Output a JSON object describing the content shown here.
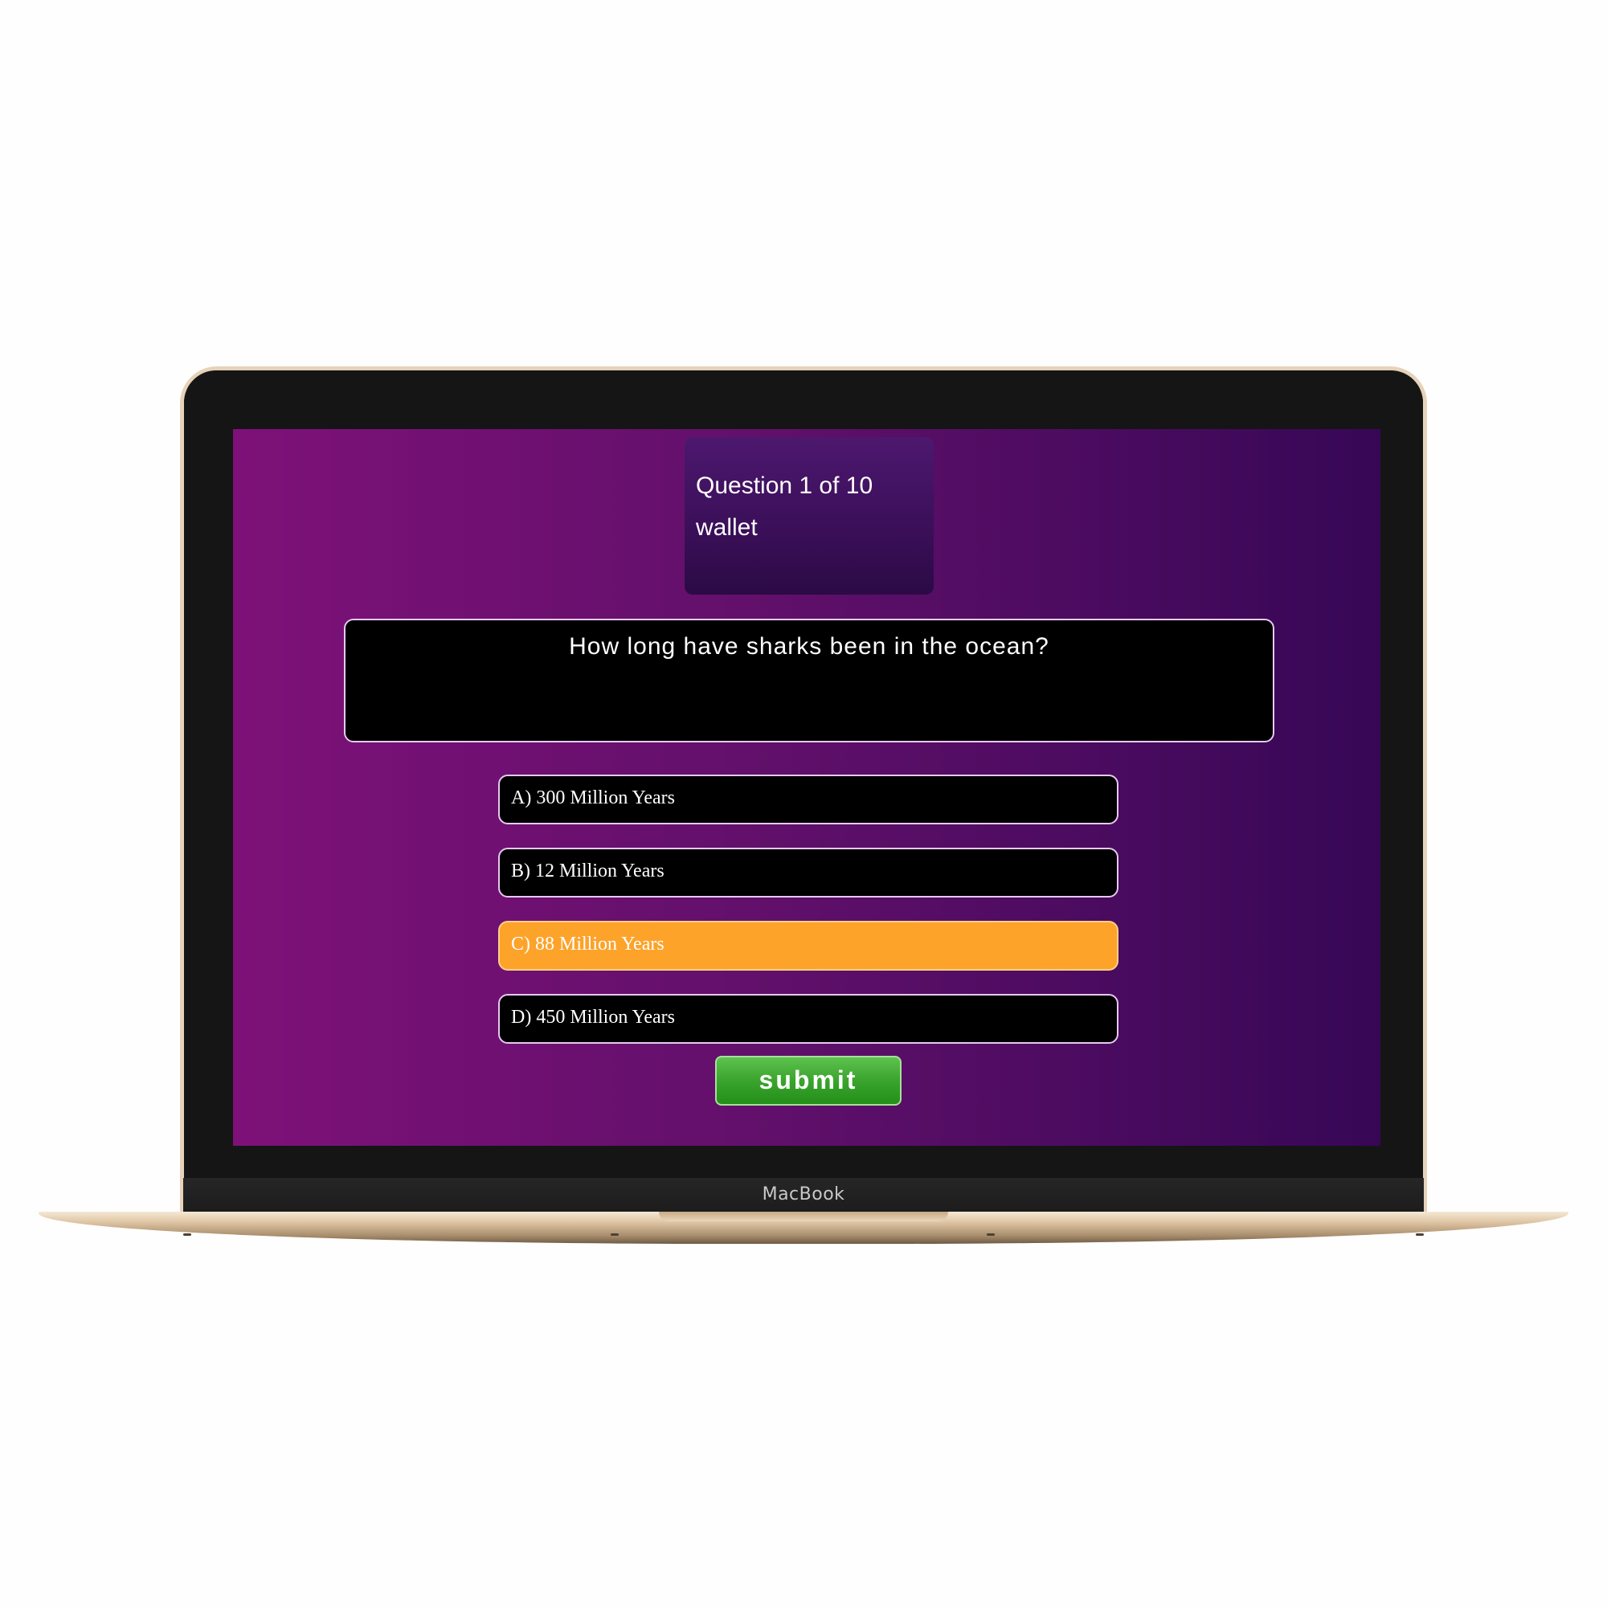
{
  "device": {
    "brand_label": "MacBook"
  },
  "quiz": {
    "progress_text": "Question 1 of 10",
    "wallet_label": "wallet",
    "question": "How long have sharks been in the ocean?",
    "options": [
      {
        "label": "A) 300 Million Years",
        "selected": false
      },
      {
        "label": "B) 12 Million Years",
        "selected": false
      },
      {
        "label": "C) 88 Million Years",
        "selected": true
      },
      {
        "label": "D) 450 Million Years",
        "selected": false
      }
    ],
    "submit_label": "submit"
  },
  "colors": {
    "gradient_start": "#7e1179",
    "gradient_end": "#370756",
    "selected_option": "#fda32a",
    "submit_button": "#3aa42d",
    "option_background": "#000000",
    "laptop_body": "#dcc2a0"
  }
}
